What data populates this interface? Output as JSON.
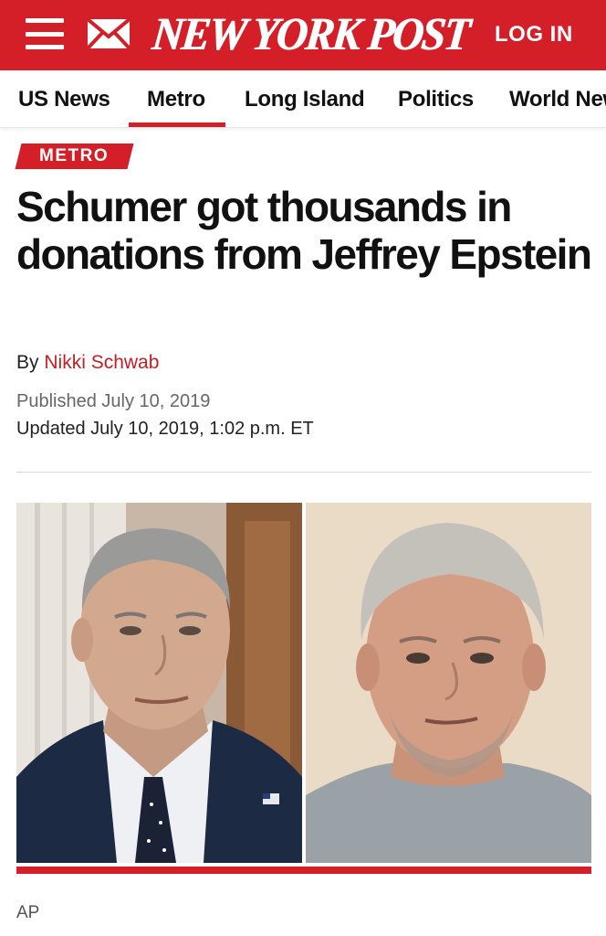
{
  "header": {
    "menu_icon": "hamburger-menu-icon",
    "mail_icon": "envelope-icon",
    "logo": "NEW YORK POST",
    "login": "LOG IN",
    "brand_color": "#d41f28"
  },
  "nav": {
    "items": [
      {
        "label": "US News"
      },
      {
        "label": "Metro",
        "active": true
      },
      {
        "label": "Long Island"
      },
      {
        "label": "Politics"
      },
      {
        "label": "World News"
      }
    ]
  },
  "article": {
    "section": "METRO",
    "headline": "Schumer got thousands in donations from Jeffrey Epstein",
    "by": "By",
    "author": "Nikki Schwab",
    "published": "Published July 10, 2019",
    "updated": "Updated July 10, 2019, 1:02 p.m. ET",
    "photo_credit": "AP"
  }
}
